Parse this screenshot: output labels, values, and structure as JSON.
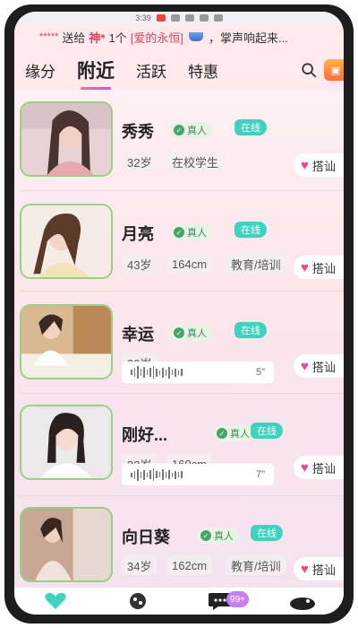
{
  "status_bar": {
    "time": "3:39"
  },
  "marquee": {
    "stars": "*****",
    "action": "送给",
    "recipient": "神*",
    "count": "1个",
    "gift_name": "[爱的永恒]",
    "tail": "，掌声响起来..."
  },
  "tabs": [
    {
      "label": "缘分",
      "active": false
    },
    {
      "label": "附近",
      "active": true
    },
    {
      "label": "活跃",
      "active": false
    },
    {
      "label": "特惠",
      "active": false
    }
  ],
  "users": [
    {
      "name": "秀秀",
      "verified_label": "真人",
      "online_label": "在线",
      "tags": [
        "32岁",
        "在校学生"
      ],
      "chat_label": "搭讪",
      "voice": null
    },
    {
      "name": "月亮",
      "verified_label": "真人",
      "online_label": "在线",
      "tags": [
        "43岁",
        "164cm",
        "教育/培训"
      ],
      "chat_label": "搭讪",
      "voice": null
    },
    {
      "name": "幸运",
      "verified_label": "真人",
      "online_label": "在线",
      "tags": [
        "33岁"
      ],
      "chat_label": "搭讪",
      "voice": "5\""
    },
    {
      "name": "刚好...",
      "verified_label": "真人",
      "online_label": "在线",
      "tags": [
        "33岁",
        "160cm"
      ],
      "chat_label": "搭讪",
      "voice": "7\""
    },
    {
      "name": "向日葵",
      "verified_label": "真人",
      "online_label": "在线",
      "tags": [
        "34岁",
        "162cm",
        "教育/培训"
      ],
      "chat_label": "搭讪",
      "voice": null
    }
  ],
  "bottom_nav": {
    "messages_badge": "99+"
  },
  "colors": {
    "accent": "#f27095",
    "online": "#3ed2bf",
    "verified": "#4aa36a",
    "heart": "#f0488a"
  }
}
